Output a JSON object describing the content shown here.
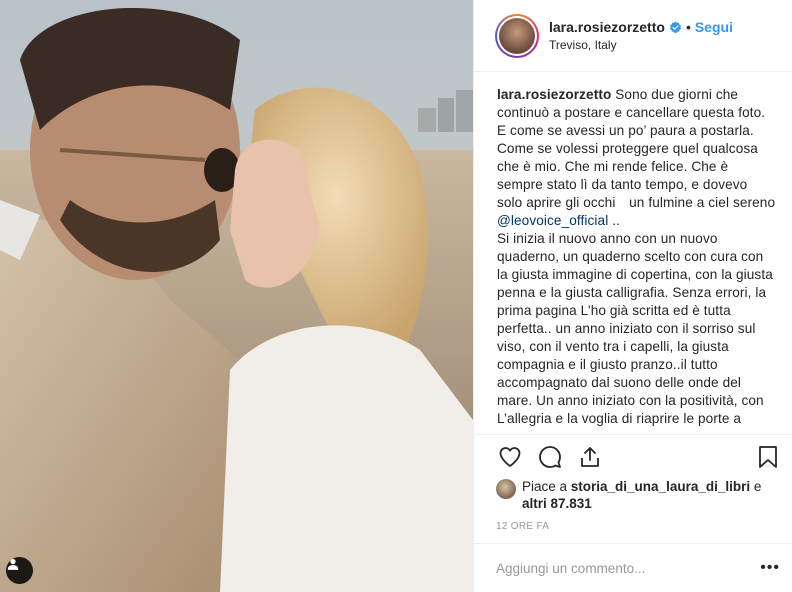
{
  "post": {
    "image_alt": "Couple kissing on the beach",
    "tag_icon": "user-tag-icon"
  },
  "header": {
    "username": "lara.rosiezorzetto",
    "verified_icon": "verified-badge-icon",
    "separator": "•",
    "follow_label": "Segui",
    "location": "Treviso, Italy"
  },
  "caption": {
    "username": "lara.rosiezorzetto",
    "text_part1": " Sono due giorni che continuò a postare e cancellare questa foto. E come se avessi un po’ paura a postarla. Come se volessi proteggere quel qualcosa che è mio. Che mi rende felice. Che è sempre stato lì da tanto tempo, e dovevo solo aprire gli occhi un fulmine a ciel sereno ",
    "mention": "@leovoice_official",
    "text_part2": " ..",
    "paragraph2": "Si inizia il nuovo anno con un nuovo quaderno, un quaderno scelto con cura con la giusta immagine di copertina, con la giusta penna e la giusta calligrafia. Senza errori, la prima pagina L’ho già scritta ed è tutta perfetta.. un anno iniziato con il sorriso sul viso, con il vento tra i capelli, la giusta compagnia e il giusto pranzo..il tutto accompagnato dal suono delle onde del mare. Un anno iniziato con la positività, con L’allegria e la voglia di riaprire le porte a"
  },
  "actions": {
    "like_icon": "heart-icon",
    "comment_icon": "comment-icon",
    "share_icon": "share-icon",
    "save_icon": "bookmark-icon"
  },
  "likes": {
    "prefix": "Piace a ",
    "liker": "storia_di_una_laura_di_libri",
    "middle": " e",
    "others": "altri 87.831"
  },
  "timestamp": "12 ORE FA",
  "comment": {
    "placeholder": "Aggiungi un commento...",
    "more_label": "•••"
  },
  "colors": {
    "accent": "#3897f0",
    "text": "#262626",
    "muted": "#999999",
    "border": "#efefef"
  }
}
